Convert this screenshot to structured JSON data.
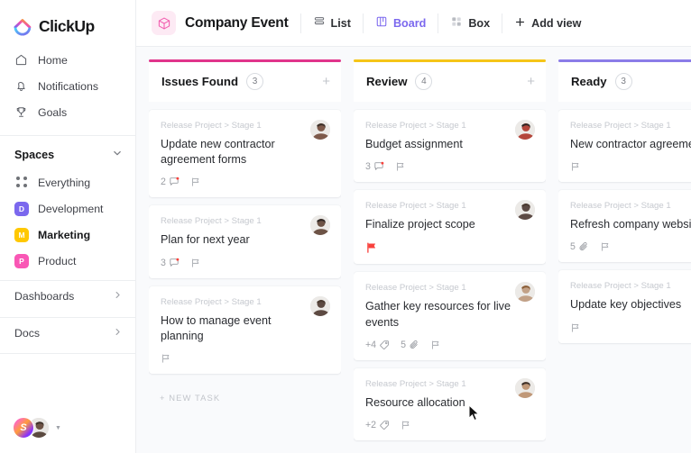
{
  "brand": {
    "name": "ClickUp",
    "logo_icon": "clickup-logo-icon"
  },
  "sidebar": {
    "nav": [
      {
        "label": "Home",
        "icon": "home-icon"
      },
      {
        "label": "Notifications",
        "icon": "bell-icon"
      },
      {
        "label": "Goals",
        "icon": "trophy-icon"
      }
    ],
    "spaces_title": "Spaces",
    "spaces_collapse_icon": "chevron-down-icon",
    "spaces": [
      {
        "label": "Everything",
        "icon": "grid-dots-icon",
        "initial": "",
        "color": ""
      },
      {
        "label": "Development",
        "icon": "space-badge",
        "initial": "D",
        "color": "#7b68ee"
      },
      {
        "label": "Marketing",
        "icon": "space-badge",
        "initial": "M",
        "color": "#ffc800",
        "active": true
      },
      {
        "label": "Product",
        "icon": "space-badge",
        "initial": "P",
        "color": "#f957b5"
      }
    ],
    "links": [
      {
        "label": "Dashboards",
        "icon": "chevron-right-icon"
      },
      {
        "label": "Docs",
        "icon": "chevron-right-icon"
      }
    ],
    "footer": {
      "workspace_initial": "S",
      "workspace_avatar_name": "workspace-avatar",
      "user_avatar_name": "user-avatar",
      "caret_icon": "caret-down-icon"
    }
  },
  "header": {
    "project_icon": "box-cube-icon",
    "title": "Company Event",
    "views": [
      {
        "label": "List",
        "icon": "list-icon",
        "active": false
      },
      {
        "label": "Board",
        "icon": "board-icon",
        "active": true
      },
      {
        "label": "Box",
        "icon": "box-grid-icon",
        "active": false
      }
    ],
    "add_view_label": "Add view",
    "add_view_icon": "plus-icon"
  },
  "board": {
    "new_task_label": "+ NEW TASK",
    "add_card_icon": "plus-icon",
    "columns": [
      {
        "name": "Issues Found",
        "count": "3",
        "accent": "#e0348b",
        "show_plus": true,
        "show_new_task": true,
        "cards": [
          {
            "breadcrumb": "Release Project > Stage 1",
            "title": "Update new contractor agreement forms",
            "avatar_tone": "#7e5a4b",
            "meta": [
              {
                "type": "subtask",
                "value": "2",
                "icon": "subtask-icon",
                "dot": true
              },
              {
                "type": "comment",
                "value": "",
                "icon": "comment-flag-icon"
              }
            ]
          },
          {
            "breadcrumb": "Release Project > Stage 1",
            "title": "Plan for next year",
            "avatar_tone": "#6d5346",
            "meta": [
              {
                "type": "subtask",
                "value": "3",
                "icon": "subtask-icon",
                "dot": true
              },
              {
                "type": "comment",
                "value": "",
                "icon": "comment-flag-icon"
              }
            ]
          },
          {
            "breadcrumb": "Release Project > Stage 1",
            "title": "How to manage event planning",
            "avatar_tone": "#5d4a42",
            "meta": [
              {
                "type": "comment",
                "value": "",
                "icon": "comment-flag-icon"
              }
            ]
          }
        ]
      },
      {
        "name": "Review",
        "count": "4",
        "accent": "#f5c518",
        "show_plus": true,
        "show_new_task": false,
        "cards": [
          {
            "breadcrumb": "Release Project > Stage 1",
            "title": "Budget assignment",
            "avatar_tone": "#b4453a",
            "meta": [
              {
                "type": "subtask",
                "value": "3",
                "icon": "subtask-icon",
                "dot": true
              },
              {
                "type": "comment",
                "value": "",
                "icon": "comment-flag-icon"
              }
            ]
          },
          {
            "breadcrumb": "Release Project > Stage 1",
            "title": "Finalize project scope",
            "avatar_tone": "#5c4a44",
            "meta": [
              {
                "type": "priority-flag",
                "value": "",
                "icon": "priority-flag-icon",
                "color": "#f8413c"
              }
            ]
          },
          {
            "breadcrumb": "Release Project > Stage 1",
            "title": "Gather key resources for live events",
            "avatar_tone": "#c2a187",
            "meta": [
              {
                "type": "tag",
                "value": "+4",
                "icon": "tag-icon"
              },
              {
                "type": "attachment",
                "value": "5",
                "icon": "paperclip-icon"
              },
              {
                "type": "comment",
                "value": "",
                "icon": "comment-flag-icon"
              }
            ]
          },
          {
            "breadcrumb": "Release Project > Stage 1",
            "title": "Resource allocation",
            "avatar_tone": "#c09878",
            "meta": [
              {
                "type": "tag",
                "value": "+2",
                "icon": "tag-icon"
              },
              {
                "type": "comment",
                "value": "",
                "icon": "comment-flag-icon"
              }
            ]
          }
        ]
      },
      {
        "name": "Ready",
        "count": "3",
        "accent": "#8b7ce8",
        "show_plus": false,
        "show_new_task": false,
        "cards": [
          {
            "breadcrumb": "Release Project > Stage 1",
            "title": "New contractor agreement",
            "avatar_tone": "",
            "meta": [
              {
                "type": "comment",
                "value": "",
                "icon": "comment-flag-icon"
              }
            ]
          },
          {
            "breadcrumb": "Release Project > Stage 1",
            "title": "Refresh company website",
            "avatar_tone": "",
            "meta": [
              {
                "type": "attachment",
                "value": "5",
                "icon": "paperclip-icon"
              },
              {
                "type": "comment",
                "value": "",
                "icon": "comment-flag-icon"
              }
            ]
          },
          {
            "breadcrumb": "Release Project > Stage 1",
            "title": "Update key objectives",
            "avatar_tone": "",
            "meta": [
              {
                "type": "comment",
                "value": "",
                "icon": "comment-flag-icon"
              }
            ]
          }
        ]
      }
    ]
  },
  "cursor": {
    "icon": "mouse-pointer-icon"
  }
}
